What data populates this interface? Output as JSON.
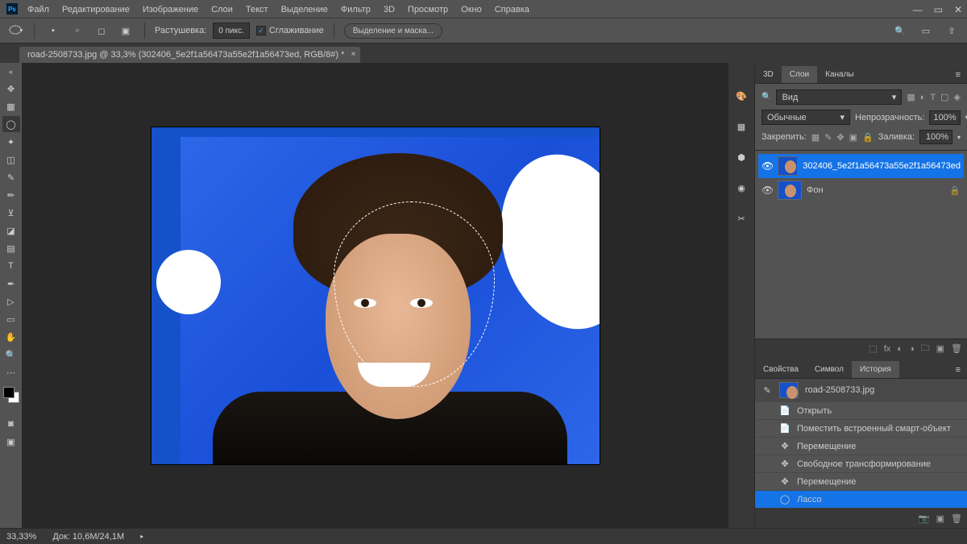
{
  "menubar": [
    "Файл",
    "Редактирование",
    "Изображение",
    "Слои",
    "Текст",
    "Выделение",
    "Фильтр",
    "3D",
    "Просмотр",
    "Окно",
    "Справка"
  ],
  "optionsBar": {
    "featherLabel": "Растушевка:",
    "featherValue": "0 пикс.",
    "antiAliasLabel": "Сглаживание",
    "antiAliasChecked": true,
    "selectMaskBtn": "Выделение и маска..."
  },
  "document": {
    "tabTitle": "road-2508733.jpg @ 33,3% (302406_5e2f1a56473a55e2f1a56473ed, RGB/8#) *"
  },
  "layersPanel": {
    "tabs": [
      "3D",
      "Слои",
      "Каналы"
    ],
    "activeTab": 1,
    "filterLabel": "Вид",
    "blendMode": "Обычные",
    "opacityLabel": "Непрозрачность:",
    "opacityValue": "100%",
    "lockLabel": "Закрепить:",
    "fillLabel": "Заливка:",
    "fillValue": "100%",
    "layers": [
      {
        "name": "302406_5e2f1a56473a55e2f1a56473ed",
        "active": true,
        "locked": false
      },
      {
        "name": "Фон",
        "active": false,
        "locked": true
      }
    ]
  },
  "propsPanel": {
    "tabs": [
      "Свойства",
      "Символ",
      "История"
    ],
    "activeTab": 2,
    "docName": "road-2508733.jpg",
    "history": [
      {
        "icon": "📄",
        "label": "Открыть"
      },
      {
        "icon": "📄",
        "label": "Поместить встроенный смарт-объект"
      },
      {
        "icon": "✥",
        "label": "Перемещение"
      },
      {
        "icon": "✥",
        "label": "Свободное трансформирование"
      },
      {
        "icon": "✥",
        "label": "Перемещение"
      },
      {
        "icon": "◯",
        "label": "Лассо",
        "active": true
      }
    ]
  },
  "statusbar": {
    "zoom": "33,33%",
    "docSize": "Док: 10,6M/24,1M"
  },
  "tools": [
    {
      "name": "move-tool",
      "glyph": "✥"
    },
    {
      "name": "marquee-tool",
      "glyph": "▦"
    },
    {
      "name": "lasso-tool",
      "glyph": "◯",
      "active": true
    },
    {
      "name": "magic-wand-tool",
      "glyph": "✦"
    },
    {
      "name": "crop-tool",
      "glyph": "◫"
    },
    {
      "name": "eyedropper-tool",
      "glyph": "✎"
    },
    {
      "name": "brush-tool",
      "glyph": "✏"
    },
    {
      "name": "stamp-tool",
      "glyph": "⊻"
    },
    {
      "name": "eraser-tool",
      "glyph": "◪"
    },
    {
      "name": "gradient-tool",
      "glyph": "▤"
    },
    {
      "name": "type-tool",
      "glyph": "T"
    },
    {
      "name": "pen-tool",
      "glyph": "✒"
    },
    {
      "name": "path-select-tool",
      "glyph": "▷"
    },
    {
      "name": "rectangle-tool",
      "glyph": "▭"
    },
    {
      "name": "hand-tool",
      "glyph": "✋"
    },
    {
      "name": "zoom-tool",
      "glyph": "🔍"
    },
    {
      "name": "more-tool",
      "glyph": "⋯"
    }
  ],
  "dockIcons": [
    "🎨",
    "▦",
    "⬢",
    "◉",
    "✂"
  ]
}
